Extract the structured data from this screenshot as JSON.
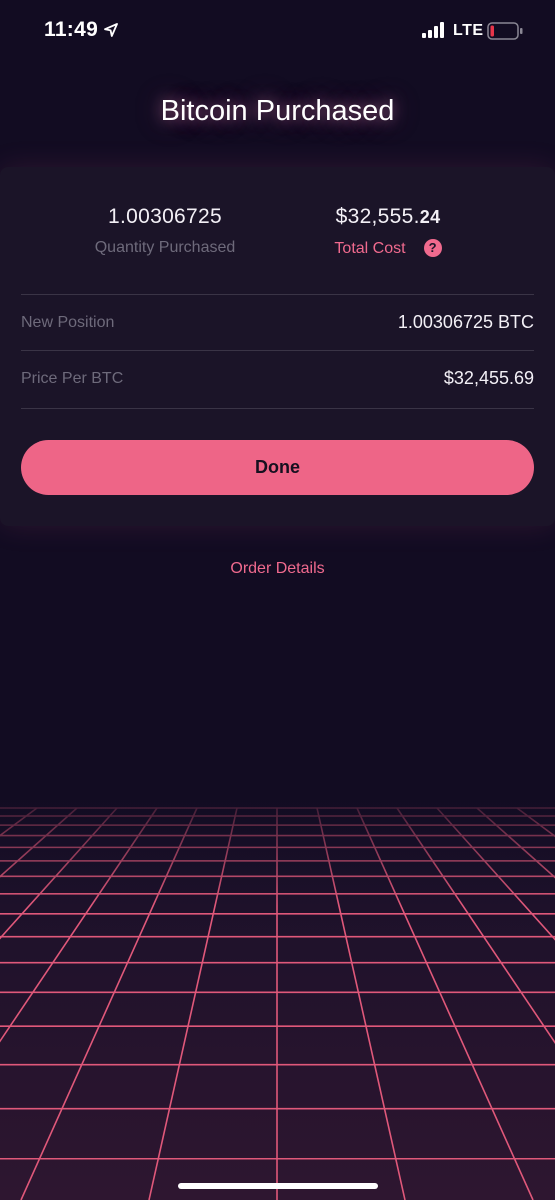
{
  "status_bar": {
    "time": "11:49",
    "network": "LTE",
    "icons": [
      "location-arrow-icon",
      "signal-icon",
      "battery-icon"
    ],
    "battery_color": "#e8354a"
  },
  "header": {
    "title": "Bitcoin Purchased"
  },
  "summary": {
    "quantity": "1.00306725",
    "quantity_label": "Quantity Purchased",
    "total_cost_main": "$32,555.",
    "total_cost_cents": "24",
    "total_cost_label": "Total Cost",
    "help_icon": "?"
  },
  "details": [
    {
      "label": "New Position",
      "value": "1.00306725 BTC"
    },
    {
      "label": "Price Per BTC",
      "value": "$32,455.69"
    }
  ],
  "actions": {
    "done_label": "Done",
    "order_details_label": "Order Details"
  },
  "colors": {
    "background": "#120c22",
    "card": "#1b1428",
    "accent": "#ee6587",
    "grid_line": "#e0587a"
  }
}
